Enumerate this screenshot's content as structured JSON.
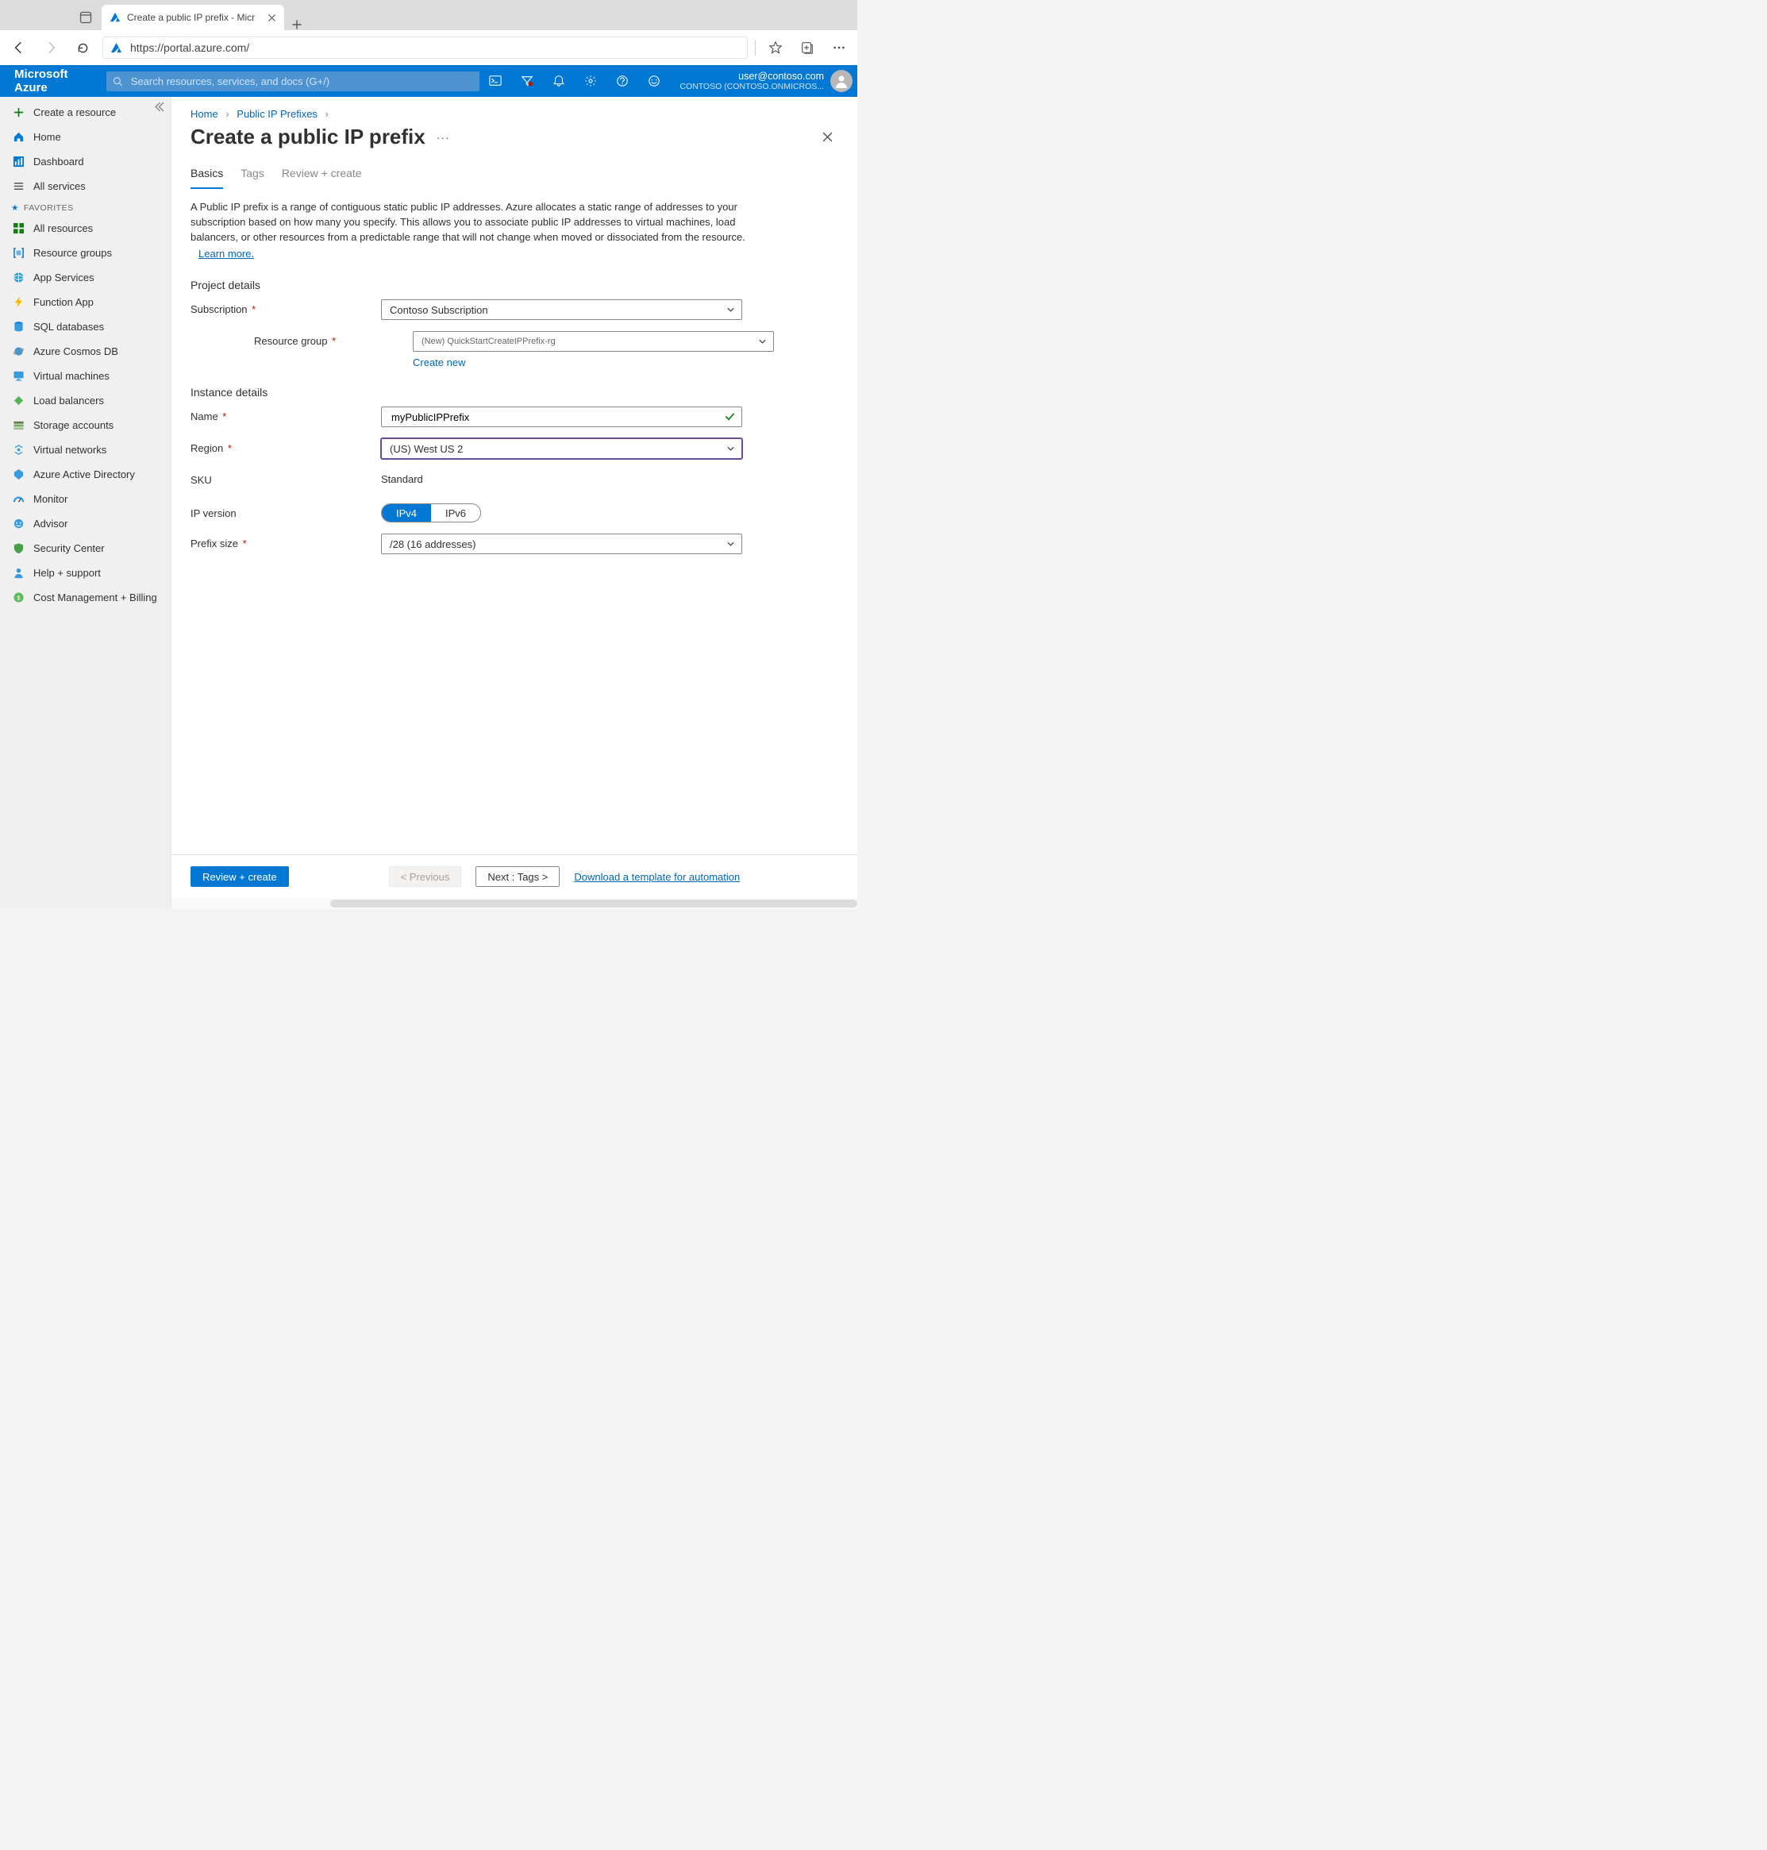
{
  "browser": {
    "tab_title": "Create a public IP prefix - Micr",
    "url": "https://portal.azure.com/"
  },
  "azure": {
    "brand": "Microsoft Azure",
    "search_placeholder": "Search resources, services, and docs (G+/)",
    "user_email": "user@contoso.com",
    "tenant": "CONTOSO (CONTOSO.ONMICROS..."
  },
  "sidebar": {
    "create": "Create a resource",
    "home": "Home",
    "dashboard": "Dashboard",
    "all_services": "All services",
    "favorites_label": "FAVORITES",
    "items": [
      "All resources",
      "Resource groups",
      "App Services",
      "Function App",
      "SQL databases",
      "Azure Cosmos DB",
      "Virtual machines",
      "Load balancers",
      "Storage accounts",
      "Virtual networks",
      "Azure Active Directory",
      "Monitor",
      "Advisor",
      "Security Center",
      "Help + support",
      "Cost Management + Billing"
    ]
  },
  "breadcrumbs": {
    "home": "Home",
    "current": "Public IP Prefixes"
  },
  "page": {
    "title": "Create a public IP prefix",
    "intro": "A Public IP prefix is a range of contiguous static public IP addresses. Azure allocates a static range of addresses to your subscription based on how many you specify. This allows you to associate public IP addresses to virtual machines, load balancers, or other resources from a predictable range that will not change when moved or dissociated from the resource.",
    "learn_more": "Learn more."
  },
  "tabs": {
    "basics": "Basics",
    "tags": "Tags",
    "review": "Review + create"
  },
  "form": {
    "project_details": "Project details",
    "subscription_label": "Subscription",
    "subscription_value": "Contoso Subscription",
    "rg_label": "Resource group",
    "rg_value": "(New) QuickStartCreateIPPrefix-rg",
    "create_new": "Create new",
    "instance_details": "Instance details",
    "name_label": "Name",
    "name_value": "myPublicIPPrefix",
    "region_label": "Region",
    "region_value": "(US) West US 2",
    "sku_label": "SKU",
    "sku_value": "Standard",
    "ipver_label": "IP version",
    "ipv4": "IPv4",
    "ipv6": "IPv6",
    "prefix_label": "Prefix size",
    "prefix_value": "/28 (16 addresses)"
  },
  "footer": {
    "review": "Review + create",
    "prev": "< Previous",
    "next": "Next : Tags >",
    "download": "Download a template for automation"
  },
  "colors": {
    "primary": "#0078d4",
    "link": "#0066b8",
    "danger": "#b41600",
    "success": "#107c10"
  }
}
